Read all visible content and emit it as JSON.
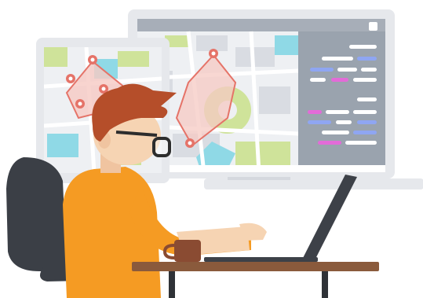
{
  "illustration": {
    "subject": "person-at-laptop-with-map-screens",
    "colors": {
      "monitor_frame": "#e6e8ec",
      "monitor_screen_bar": "#a7aeb8",
      "map_land": "#eef0f3",
      "map_park": "#cfe39a",
      "map_water": "#8fd9e6",
      "route_area": "#f6c9c3",
      "route_line": "#e57368",
      "pin": "#e57368",
      "code_panel": "#9aa3ae",
      "code_white": "#ffffff",
      "code_blue": "#8fa6f2",
      "code_pink": "#e36bd8",
      "hair": "#b54e2a",
      "skin": "#f6d4b3",
      "shirt": "#f59b23",
      "chair": "#3b3f46",
      "desk_top": "#8a5a3c",
      "desk_legs": "#2f3237",
      "laptop": "#3d4148",
      "mug": "#8a4b32"
    },
    "icons": [
      "map-pin-icon",
      "window-button-icon"
    ]
  }
}
